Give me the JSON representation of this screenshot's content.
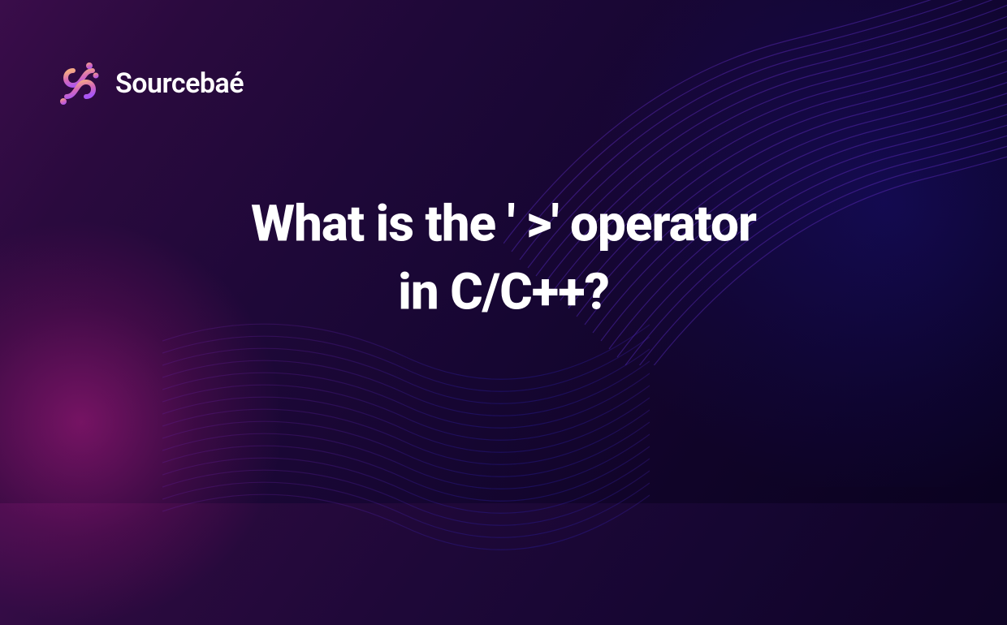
{
  "brand": {
    "name": "Sourcebaé",
    "icon_name": "sourcebae-logo"
  },
  "headline": {
    "text": "What is the '  >' operator\nin C/C++?"
  },
  "colors": {
    "background_start": "#3a0d4a",
    "background_end": "#0a0220",
    "accent_magenta": "#c81e8c",
    "accent_blue": "#2a2ae0",
    "logo_gradient_start": "#f4a986",
    "logo_gradient_end": "#a855f7",
    "text": "#ffffff"
  }
}
